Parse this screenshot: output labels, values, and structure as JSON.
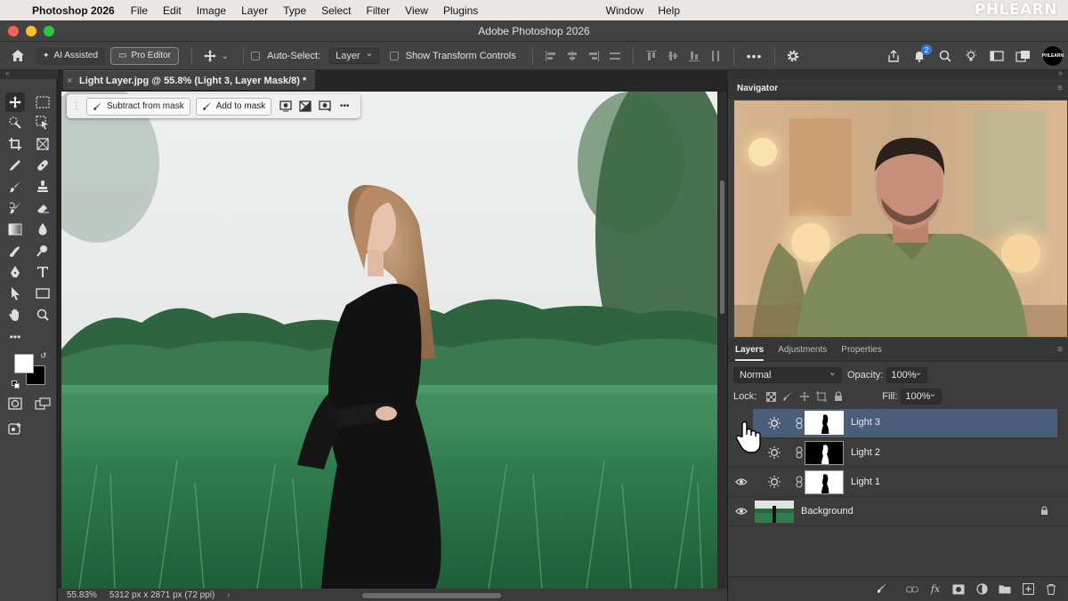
{
  "menubar": {
    "app": "Photoshop 2026",
    "items": [
      "File",
      "Edit",
      "Image",
      "Layer",
      "Type",
      "Select",
      "Filter",
      "View",
      "Plugins"
    ],
    "right_items": [
      "Window",
      "Help"
    ],
    "watermark": "PHLEARN"
  },
  "window": {
    "title": "Adobe Photoshop 2026"
  },
  "options": {
    "ai_assisted": "AI Assisted",
    "pro_editor": "Pro Editor",
    "auto_select_label": "Auto-Select:",
    "auto_select_value": "Layer",
    "show_transform": "Show Transform Controls",
    "notification_count": "2",
    "profile_logo": "PHLEARN"
  },
  "document": {
    "tab_title": "Light Layer.jpg @ 55.8% (Light 3, Layer Mask/8) *",
    "zoom": "55.83%",
    "dimensions": "5312 px x 2871 px (72 ppi)"
  },
  "context_bar": {
    "subtract": "Subtract from mask",
    "add": "Add to mask"
  },
  "navigator": {
    "title": "Navigator"
  },
  "layers_panel": {
    "tabs": [
      "Layers",
      "Adjustments",
      "Properties"
    ],
    "blend_mode": "Normal",
    "opacity_label": "Opacity:",
    "opacity": "100%",
    "lock_label": "Lock:",
    "fill_label": "Fill:",
    "fill": "100%",
    "layers": [
      {
        "name": "Light 3",
        "selected": true
      },
      {
        "name": "Light 2",
        "selected": false
      },
      {
        "name": "Light 1",
        "selected": false
      },
      {
        "name": "Background",
        "selected": false
      }
    ]
  },
  "colors": {
    "accent": "#4a5d79",
    "panel_bg": "#3c3c3c",
    "chrome": "#424242"
  }
}
